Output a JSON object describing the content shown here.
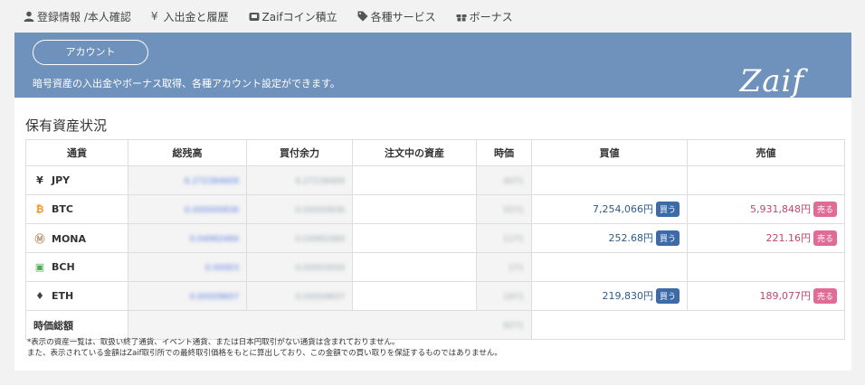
{
  "nav": {
    "items": [
      {
        "label": "登録情報 /本人確認",
        "icon": "person-icon"
      },
      {
        "label": "入出金と履歴",
        "icon": "yen-icon"
      },
      {
        "label": "Zaifコイン積立",
        "icon": "piggy-icon"
      },
      {
        "label": "各種サービス",
        "icon": "tag-icon"
      },
      {
        "label": "ボーナス",
        "icon": "gift-icon"
      }
    ]
  },
  "banner": {
    "account_label": "アカウント",
    "description": "暗号資産の入出金やボーナス取得、各種アカウント設定ができます。",
    "logo": "Zaif"
  },
  "assets": {
    "title": "保有資産状況",
    "headers": [
      "通貨",
      "総残高",
      "買付余力",
      "注文中の資産",
      "時価",
      "買値",
      "売値"
    ],
    "rows": [
      {
        "currency": "JPY",
        "icon": "¥",
        "icon_color": "#333",
        "total": "6.272384609",
        "available": "6.27238469",
        "price": "4071",
        "buy": "",
        "sell": ""
      },
      {
        "currency": "BTC",
        "icon": "₿",
        "icon_color": "#f7931a",
        "total": "0.000000836",
        "available": "0.00000836",
        "price": "5571",
        "buy": "7,254,066円",
        "sell": "5,931,848円"
      },
      {
        "currency": "MONA",
        "icon": "Ⓜ",
        "icon_color": "#b8956b",
        "total": "0.04982484",
        "available": "0.04982484",
        "price": "1171",
        "buy": "252.68円",
        "sell": "221.16円"
      },
      {
        "currency": "BCH",
        "icon": "▣",
        "icon_color": "#4caf50",
        "total": "0.00003",
        "available": "0.00003000",
        "price": "171",
        "buy": "",
        "sell": ""
      },
      {
        "currency": "ETH",
        "icon": "♦",
        "icon_color": "#444",
        "total": "0.00009607",
        "available": "0.00009607",
        "price": "1971",
        "buy": "219,830円",
        "sell": "189,077円"
      }
    ],
    "total_label": "時価総額",
    "total_value": "9271",
    "buy_button": "買う",
    "sell_button": "売る"
  },
  "notes": {
    "line1": "*表示の資産一覧は、取扱い終了通貨、イベント通貨、または日本円取引がない通貨は含まれておりません。",
    "line2": "また、表示されている金額はZaif取引所での最終取引価格をもとに算出しており、この金額での買い取りを保証するものではありません。"
  }
}
